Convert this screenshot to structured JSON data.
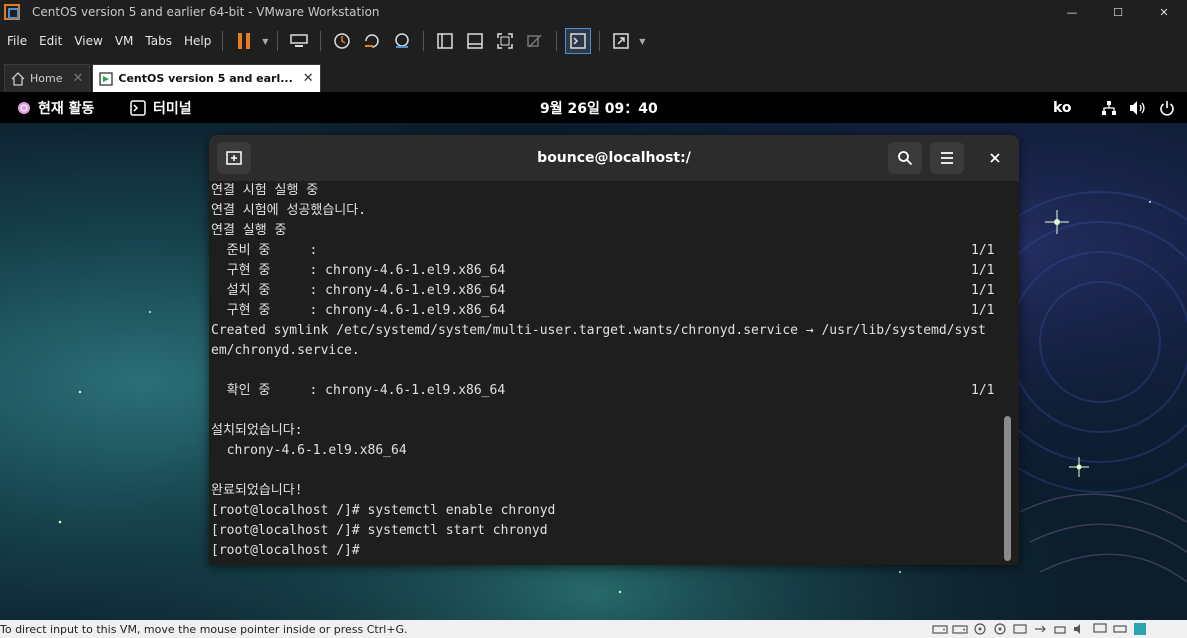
{
  "window": {
    "title": "CentOS version 5 and earlier 64-bit - VMware Workstation",
    "minimize": "—",
    "maximize": "☐",
    "close": "✕"
  },
  "menu": [
    "File",
    "Edit",
    "View",
    "VM",
    "Tabs",
    "Help"
  ],
  "tabs": [
    {
      "label": "Home",
      "icon": "home-icon"
    },
    {
      "label": "CentOS version 5 and earl...",
      "icon": "vm-icon"
    }
  ],
  "gnome": {
    "activities": "현재 활동",
    "app": "터미널",
    "clock": "9월 26일  09：40",
    "lang": "ko"
  },
  "terminal": {
    "title": "bounce@localhost:/",
    "lines": [
      "연결 시험 실행 중",
      "연결 시험에 성공했습니다.",
      "연결 실행 중",
      "  준비 중     :",
      "  구현 중     : chrony-4.6-1.el9.x86_64",
      "  설치 중     : chrony-4.6-1.el9.x86_64",
      "  구현 중     : chrony-4.6-1.el9.x86_64",
      "Created symlink /etc/systemd/system/multi-user.target.wants/chronyd.service → /usr/lib/systemd/syst",
      "em/chronyd.service.",
      "",
      "  확인 중     : chrony-4.6-1.el9.x86_64",
      "",
      "설치되었습니다:",
      "  chrony-4.6-1.el9.x86_64",
      "",
      "완료되었습니다!",
      "[root@localhost /]# systemctl enable chronyd",
      "[root@localhost /]# systemctl start chronyd",
      "[root@localhost /]#"
    ],
    "counters": [
      {
        "row": 3,
        "text": "1/1"
      },
      {
        "row": 4,
        "text": "1/1"
      },
      {
        "row": 5,
        "text": "1/1"
      },
      {
        "row": 6,
        "text": "1/1"
      },
      {
        "row": 10,
        "text": "1/1"
      }
    ]
  },
  "status": {
    "hint": "To direct input to this VM, move the mouse pointer inside or press Ctrl+G."
  },
  "colors": {
    "terminal_bg": "#1e1e1e",
    "header_bg": "#2c2c2c",
    "accent": "#4a8fd0"
  }
}
